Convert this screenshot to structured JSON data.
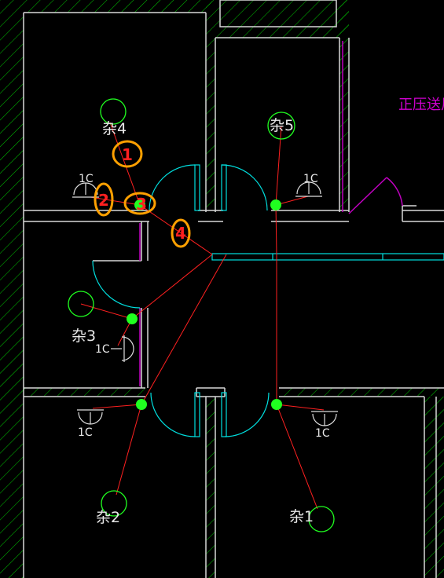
{
  "labels": {
    "za1": "杂1",
    "za2": "杂2",
    "za3": "杂3",
    "za4": "杂4",
    "za5": "杂5",
    "socket_1c": "1C",
    "pressure_note": "正压送风"
  },
  "markers": {
    "m1": "1",
    "m2": "2",
    "m3": "3",
    "m4": "4"
  },
  "colors": {
    "background": "#000000",
    "wall": "#d8d8d8",
    "hatch": "#00c800",
    "cyan": "#00e0e0",
    "wire": "#ff2020",
    "node": "#20ff20",
    "label": "#e8e8e8",
    "magenta": "#c000c0",
    "marker_ring": "#ffa000",
    "marker_text": "#ff2020"
  }
}
